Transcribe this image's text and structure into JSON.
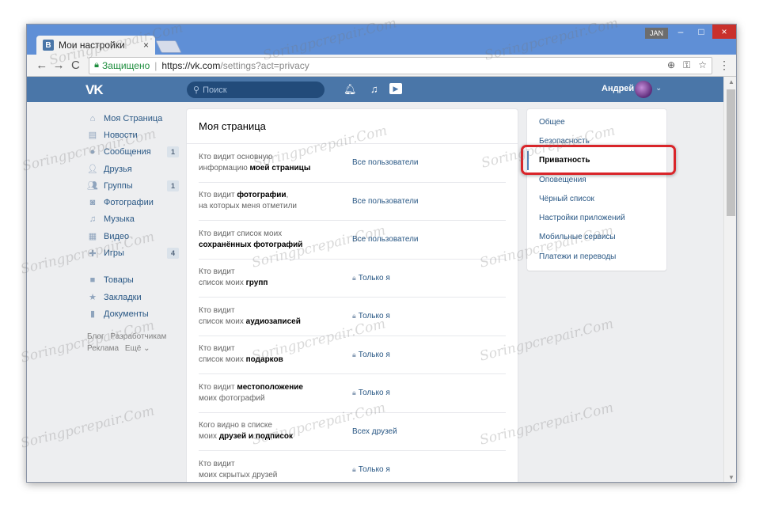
{
  "browser": {
    "tab_title": "Мои настройки",
    "tab_close": "×",
    "profile_badge": "JAN",
    "window_min": "–",
    "window_max": "□",
    "window_close": "×",
    "nav_back": "←",
    "nav_forward": "→",
    "nav_reload": "C",
    "secure_label": "Защищено",
    "url_base": "https://vk.com",
    "url_rest": "/settings?act=privacy"
  },
  "header": {
    "logo": "VK",
    "search_placeholder": "Поиск",
    "user_name": "Андрей"
  },
  "leftmenu": {
    "items": [
      {
        "label": "Моя Страница",
        "icon": "home-icon",
        "count": ""
      },
      {
        "label": "Новости",
        "icon": "news-icon",
        "count": ""
      },
      {
        "label": "Сообщения",
        "icon": "messages-icon",
        "count": "1"
      },
      {
        "label": "Друзья",
        "icon": "friends-icon",
        "count": ""
      },
      {
        "label": "Группы",
        "icon": "groups-icon",
        "count": "1"
      },
      {
        "label": "Фотографии",
        "icon": "camera-icon",
        "count": ""
      },
      {
        "label": "Музыка",
        "icon": "music-icon",
        "count": ""
      },
      {
        "label": "Видео",
        "icon": "film-icon",
        "count": ""
      },
      {
        "label": "Игры",
        "icon": "gamepad-icon",
        "count": "4"
      }
    ],
    "items2": [
      {
        "label": "Товары",
        "icon": "bag-icon"
      },
      {
        "label": "Закладки",
        "icon": "star-icon"
      },
      {
        "label": "Документы",
        "icon": "document-icon"
      }
    ],
    "footer": {
      "blog": "Блог",
      "dev": "Разработчикам",
      "ads": "Реклама",
      "more": "Ещё ⌄"
    }
  },
  "privacy": {
    "title": "Моя страница",
    "rows": [
      {
        "q1": "Кто видит основную",
        "q2": "информацию ",
        "q2b": "моей страницы",
        "value": "Все пользователи",
        "locked": false
      },
      {
        "q1": "Кто видит ",
        "q1b": "фотографии",
        "q1c": ",",
        "q2": "на которых меня отметили",
        "value": "Все пользователи",
        "locked": false
      },
      {
        "q1": "Кто видит список моих",
        "q2b": "сохранённых фотографий",
        "value": "Все пользователи",
        "locked": false
      },
      {
        "q1": "Кто видит",
        "q2": "список моих ",
        "q2b": "групп",
        "value": "Только я",
        "locked": true
      },
      {
        "q1": "Кто видит",
        "q2": "список моих ",
        "q2b": "аудиозаписей",
        "value": "Только я",
        "locked": true
      },
      {
        "q1": "Кто видит",
        "q2": "список моих ",
        "q2b": "подарков",
        "value": "Только я",
        "locked": true
      },
      {
        "q1": "Кто видит ",
        "q1b": "местоположение",
        "q2": "моих фотографий",
        "value": "Только я",
        "locked": true
      },
      {
        "q1": "Кого видно в списке",
        "q2": "моих ",
        "q2b": "друзей и подписок",
        "value": "Всех друзей",
        "locked": false
      },
      {
        "q1": "Кто видит",
        "q2": "моих скрытых друзей",
        "value": "Только я",
        "locked": true
      }
    ]
  },
  "settings_nav": {
    "items": [
      {
        "label": "Общее",
        "active": false
      },
      {
        "label": "Безопасность",
        "active": false
      },
      {
        "label": "Приватность",
        "active": true
      },
      {
        "label": "Оповещения",
        "active": false
      },
      {
        "label": "Чёрный список",
        "active": false
      },
      {
        "label": "Настройки приложений",
        "active": false
      },
      {
        "label": "Мобильные сервисы",
        "active": false
      },
      {
        "label": "Платежи и переводы",
        "active": false
      }
    ]
  },
  "watermark": "Soringpcrepair.Com",
  "colors": {
    "vk_blue": "#4a76a8",
    "link": "#2a5885",
    "highlight_red": "#d9252a",
    "browser_frame": "#5f8fd6"
  }
}
